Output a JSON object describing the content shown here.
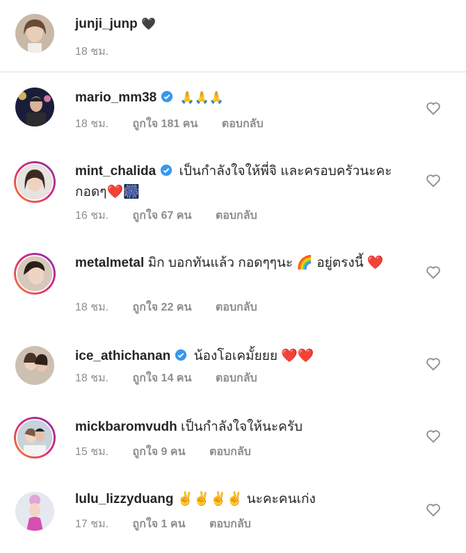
{
  "caption": {
    "username": "junji_junp",
    "emoji": "🖤",
    "time": "18 ชม."
  },
  "comments": [
    {
      "username": "mario_mm38",
      "verified": true,
      "text": "🙏🙏🙏",
      "time": "18 ชม.",
      "likes": "ถูกใจ 181 คน",
      "reply": "ตอบกลับ"
    },
    {
      "username": "mint_chalida",
      "verified": true,
      "text": "เป็นกำลังใจให้พี่จิ และครอบครัวนะคะ กอดๆ❤️🎆",
      "time": "16 ชม.",
      "likes": "ถูกใจ 67 คน",
      "reply": "ตอบกลับ"
    },
    {
      "username": "metalmetal",
      "verified": false,
      "text": "มิก บอกทันแล้ว กอดๆๆนะ 🌈 อยู่ตรงนี้ ❤️",
      "time": "18 ชม.",
      "likes": "ถูกใจ 22 คน",
      "reply": "ตอบกลับ"
    },
    {
      "username": "ice_athichanan",
      "verified": true,
      "text": "น้องโอเคมั้ยยย ❤️❤️",
      "time": "18 ชม.",
      "likes": "ถูกใจ 14 คน",
      "reply": "ตอบกลับ"
    },
    {
      "username": "mickbaromvudh",
      "verified": false,
      "text": "เป็นกำลังใจให้นะครับ",
      "time": "15 ชม.",
      "likes": "ถูกใจ 9 คน",
      "reply": "ตอบกลับ"
    },
    {
      "username": "lulu_lizzyduang",
      "verified": false,
      "text": "✌️✌️✌️✌️ นะคะคนเก่ง",
      "time": "17 ชม.",
      "likes": "ถูกใจ 1 คน",
      "reply": "ตอบกลับ"
    }
  ],
  "colors": {
    "accent_verified": "#3897f0",
    "muted": "#8e8e8e",
    "text": "#262626"
  }
}
